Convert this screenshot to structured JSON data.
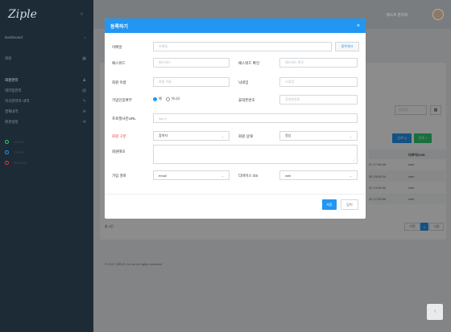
{
  "sidebar": {
    "logo": "Ziple",
    "close_icon": "×",
    "items": [
      {
        "label": "Dashboard",
        "icon": "home-icon",
        "glyph": "⌂",
        "active": false
      },
      {
        "label": "회원",
        "icon": "grid-icon",
        "glyph": "▦",
        "active": false
      },
      {
        "label": "회원관리",
        "icon": "users-icon",
        "glyph": "♟",
        "active": true
      },
      {
        "label": "대리점관리",
        "icon": "calendar-icon",
        "glyph": "▤",
        "active": false
      },
      {
        "label": "지식관리자 내역",
        "icon": "pencil-icon",
        "glyph": "✎",
        "active": false
      },
      {
        "label": "결제내역",
        "icon": "globe-icon",
        "glyph": "⊕",
        "active": false
      },
      {
        "label": "환경설정",
        "icon": "gear-icon",
        "glyph": "✲",
        "active": false
      }
    ],
    "status": [
      {
        "label": "Active",
        "color": "#2ecc71"
      },
      {
        "label": "Check",
        "color": "#2196f3"
      },
      {
        "label": "Warning",
        "color": "#e53935"
      }
    ]
  },
  "topbar": {
    "user_name": "테스트 관리자"
  },
  "modal": {
    "title": "등록하기",
    "close": "×",
    "fields": {
      "email_label": "이메일",
      "email_placeholder": "이메일",
      "check_button": "중복체크",
      "password_label": "패스워드",
      "password_placeholder": "패스워드",
      "password_confirm_label": "패스워드 확인",
      "password_confirm_placeholder": "패스워드 확인",
      "name_label": "회원 이름",
      "name_placeholder": "회원 이름",
      "nickname_label": "닉네임",
      "nickname_placeholder": "닉네임",
      "auth_label": "가입인증여부",
      "auth_yes": "예",
      "auth_no": "아니오",
      "phone_label": "휴대폰번호",
      "phone_placeholder": "휴대폰번호",
      "profile_label": "프로필사진URL",
      "profile_placeholder": "http://",
      "member_type_label": "회원 구분",
      "member_type_value": "참여자",
      "member_status_label": "회원 상태",
      "member_status_value": "정상",
      "memo_label": "회원메모",
      "join_path_label": "가입 경로",
      "join_path_value": "email",
      "device_os_label": "디바이스 OS",
      "device_os_value": "web"
    },
    "save": "저장",
    "close_button": "닫기"
  },
  "background": {
    "search_placeholder": "검색일",
    "search_button": "검색 Q",
    "register_button": "등록 +",
    "device_col": "디바이스OS",
    "rows": [
      {
        "date": "07 17:06:49",
        "os": "web"
      },
      {
        "date": "05 19:06:24",
        "os": "web"
      },
      {
        "date": "02 14:06:32",
        "os": "web"
      },
      {
        "date": "31 17:05:59",
        "os": "web"
      }
    ],
    "total": "총 4건",
    "prev": "이전",
    "page": "1",
    "next": "다음",
    "footer": "© 2017 ZIPLE Co.Ltd All rights reserved"
  }
}
